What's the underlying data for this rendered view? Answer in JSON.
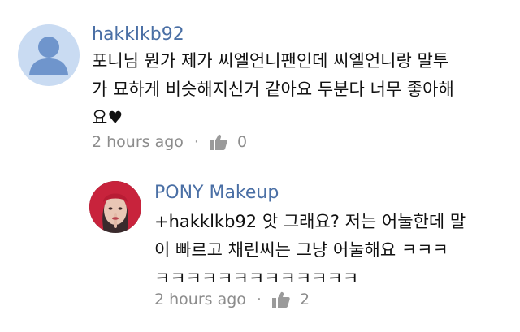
{
  "colors": {
    "author_name": "#4a6fa5",
    "text": "#111111",
    "meta": "#8c8c8c",
    "default_avatar_bg": "#c9dbf2",
    "default_avatar_fg": "#6f95cc"
  },
  "comments": [
    {
      "author": "hakklkb92",
      "avatar_icon": "default-user-icon",
      "body_lines": [
        "포니님 뭔가 제가 씨엘언니팬인데 씨엘언니랑 말투",
        "가 묘하게 비슷해지신거 같아요 두분다 너무 좋아해",
        "요♥"
      ],
      "timestamp": "2 hours ago",
      "separator": "·",
      "like_icon": "thumbs-up-icon",
      "like_count": "0"
    }
  ],
  "reply": {
    "author": "PONY Makeup",
    "avatar_icon": "profile-photo",
    "body_lines": [
      "+hakklkb92 앗 그래요? 저는 어눌한데 말",
      "이 빠르고 채린씨는 그냥 어눌해요 ㅋㅋㅋ",
      "ㅋㅋㅋㅋㅋㅋㅋㅋㅋㅋㅋㅋㅋ"
    ],
    "timestamp": "2 hours ago",
    "separator": "·",
    "like_icon": "thumbs-up-icon",
    "like_count": "2"
  }
}
